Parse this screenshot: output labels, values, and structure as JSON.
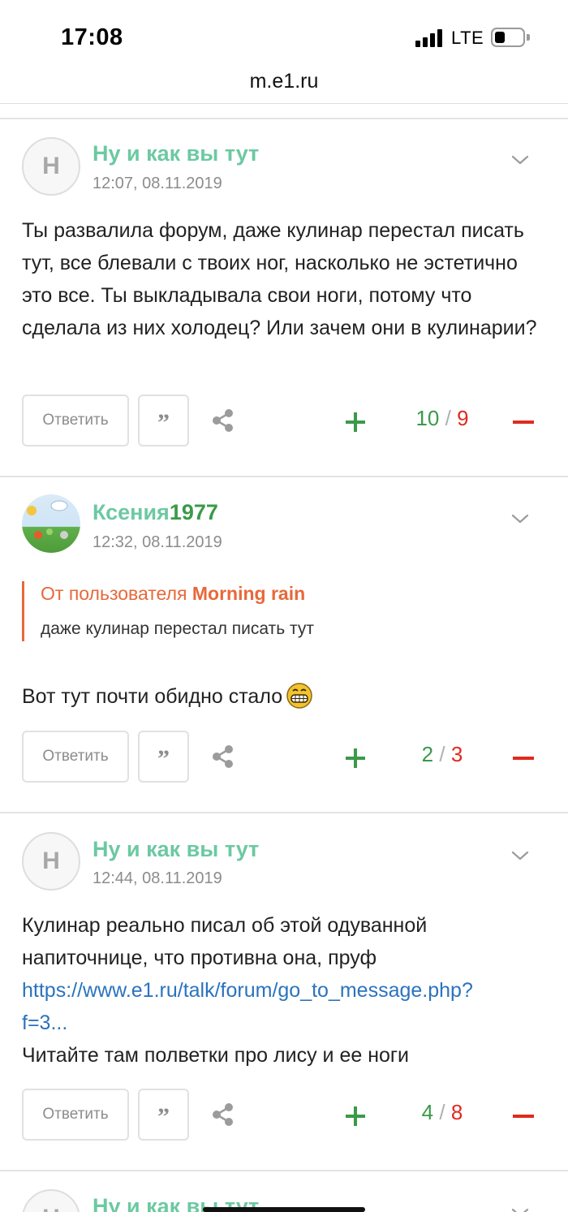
{
  "status_bar": {
    "time": "17:08",
    "network": "LTE"
  },
  "browser": {
    "url": "m.e1.ru"
  },
  "posts": [
    {
      "avatar_letter": "Н",
      "author": "Ну и как вы тут",
      "date": "12:07, 08.11.2019",
      "text": "Ты развалила форум, даже кулинар перестал писать тут, все блевали с твоих ног, насколько не эстетично это все. Ты выкладывала свои ноги, потому что сделала из них холодец? Или зачем они в кулинарии?",
      "reply_label": "Ответить",
      "quote_label": "”",
      "score_plus": "10",
      "score_sep": "/",
      "score_minus": "9"
    },
    {
      "author": "Ксения",
      "author_suffix": "1977",
      "date": "12:32, 08.11.2019",
      "quote_prefix": "От пользователя",
      "quote_user": "Morning rain",
      "quote_text": "даже кулинар перестал писать тут",
      "text": "Вот тут почти обидно стало",
      "reply_label": "Ответить",
      "quote_label": "”",
      "score_plus": "2",
      "score_sep": "/",
      "score_minus": "3"
    },
    {
      "avatar_letter": "Н",
      "author": "Ну и как вы тут",
      "date": "12:44, 08.11.2019",
      "text_line1": "Кулинар реально писал об этой одуванной",
      "text_line2": "напиточнице, что противна она, пруф",
      "link_line1": "https://www.e1.ru/talk/forum/go_to_message.php?",
      "link_line2": "f=3...",
      "text_line3": "Читайте там полветки про лису и ее ноги",
      "reply_label": "Ответить",
      "quote_label": "”",
      "score_plus": "4",
      "score_sep": "/",
      "score_minus": "8"
    },
    {
      "avatar_letter": "Н",
      "author": "Ну и как вы тут"
    }
  ],
  "colors": {
    "author": "#6cc9a2",
    "score_positive": "#3a9a48",
    "score_negative": "#e02a1e",
    "quote_accent": "#e8683a",
    "link": "#2b73bd"
  },
  "icons": [
    "signal-icon",
    "battery-icon",
    "chevron-down-icon",
    "share-icon",
    "plus-icon",
    "minus-icon",
    "grin-emoji-icon"
  ]
}
